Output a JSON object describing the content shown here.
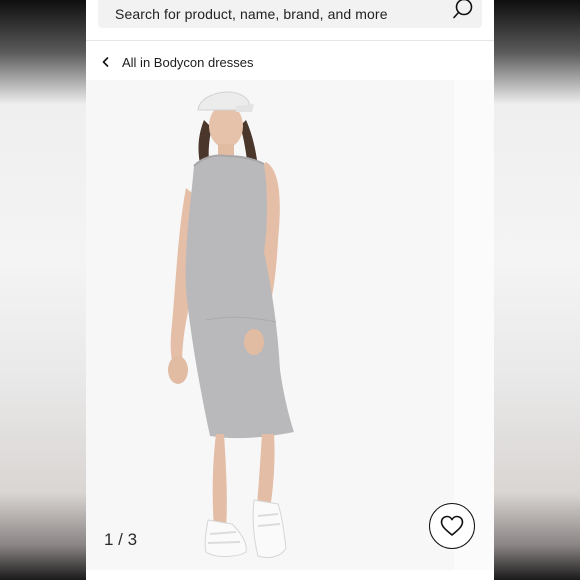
{
  "search": {
    "placeholder": "Search for product, name, brand, and more",
    "icon": "search-icon"
  },
  "breadcrumb": {
    "icon": "chevron-left-icon",
    "label": "All in Bodycon dresses"
  },
  "gallery": {
    "image": "model wearing grey sleeveless bodycon midi dress with white cap and white sneakers",
    "counter": "1 / 3"
  },
  "favorite": {
    "icon": "heart-icon"
  },
  "colors": {
    "page_background": "#ffffff",
    "search_background": "#f2f2f2",
    "dress_grey": "#b7b7b9"
  }
}
